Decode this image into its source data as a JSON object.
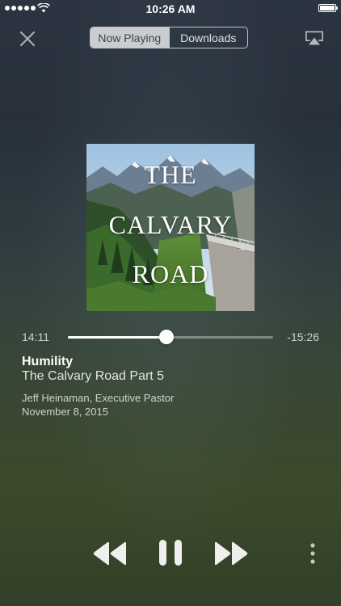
{
  "status_bar": {
    "time": "10:26 AM"
  },
  "nav": {
    "tabs": [
      {
        "label": "Now Playing",
        "active": true
      },
      {
        "label": "Downloads",
        "active": false
      }
    ],
    "close_icon": "close-icon",
    "airplay_icon": "airplay-icon"
  },
  "artwork": {
    "lines": [
      "THE",
      "CALVARY",
      "ROAD"
    ]
  },
  "player": {
    "elapsed": "14:11",
    "remaining": "-15:26",
    "progress_fraction": 0.48
  },
  "track": {
    "title": "Humility",
    "series": "The Calvary Road Part 5",
    "speaker": "Jeff Heinaman, Executive Pastor",
    "date": "November 8, 2015"
  },
  "controls": {
    "rewind_icon": "rewind-icon",
    "pause_icon": "pause-icon",
    "forward_icon": "fast-forward-icon",
    "more_icon": "more-vertical-icon"
  },
  "colors": {
    "accent": "#ffffff",
    "segment_active_text": "#3b4450"
  }
}
